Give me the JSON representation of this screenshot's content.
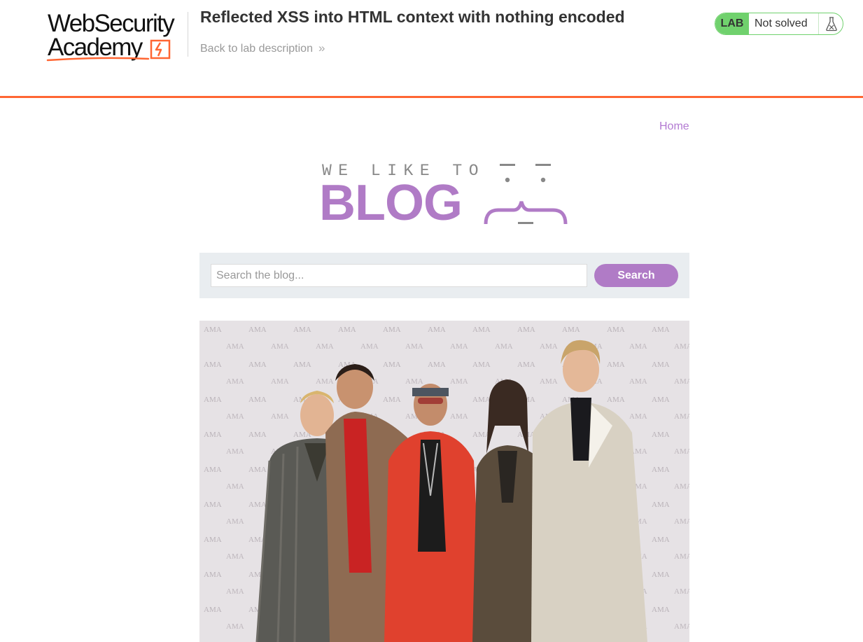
{
  "academy_header": {
    "logo": {
      "line1": "WebSecurity",
      "line2": "Academy"
    },
    "lab_title": "Reflected XSS into HTML context with nothing encoded",
    "back_link": {
      "label": "Back to lab description",
      "chevron": "»"
    },
    "lab_status": {
      "tag": "LAB",
      "status": "Not solved",
      "icon": "flask-icon",
      "color": "#70d16d"
    },
    "accent_color": "#ff6633"
  },
  "nav": {
    "home_label": "Home",
    "link_color": "#b37ad2"
  },
  "blog_logo": {
    "tagline": "WE LIKE TO",
    "wordmark": "BLOG",
    "brand_color": "#b07bc6"
  },
  "search": {
    "placeholder": "Search the blog...",
    "value": "",
    "button_label": "Search"
  },
  "post": {
    "image": "group-photo"
  }
}
